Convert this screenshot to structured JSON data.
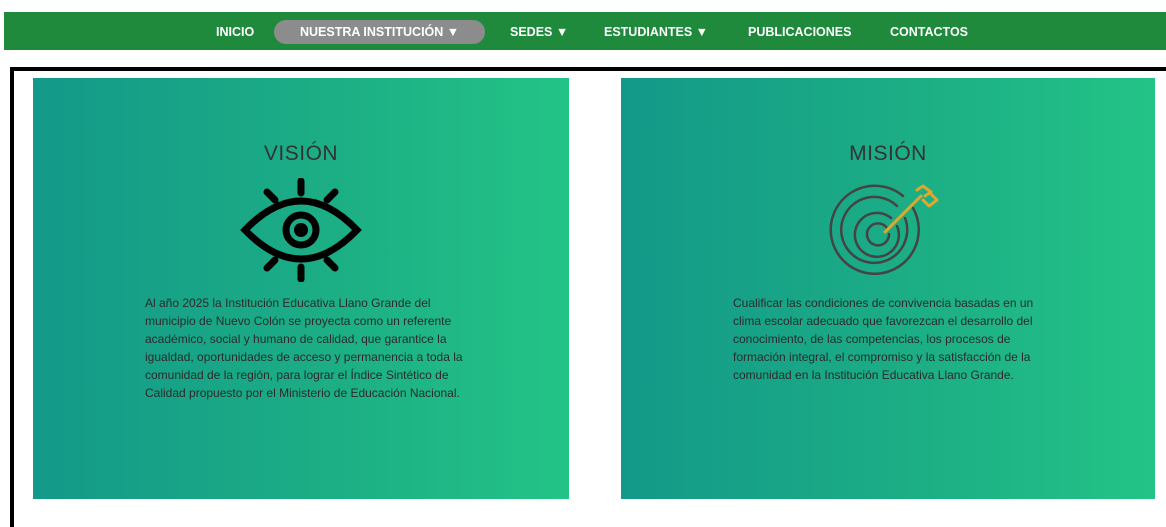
{
  "nav": {
    "items": [
      {
        "label": "INICIO"
      },
      {
        "label": "NUESTRA INSTITUCIÓN ▼"
      },
      {
        "label": "SEDES ▼"
      },
      {
        "label": "ESTUDIANTES ▼"
      },
      {
        "label": "PUBLICACIONES"
      },
      {
        "label": "CONTACTOS"
      }
    ],
    "active_index": 1
  },
  "vision": {
    "title": "VISIÓN",
    "icon": "eye-icon",
    "text": "Al año 2025 la Institución Educativa Llano Grande del municipio de Nuevo Colón se proyecta como un referente académico, social y humano de calidad, que garantice la igualdad, oportunidades de acceso y permanencia a toda la comunidad de la región, para lograr el Índice Sintético de Calidad propuesto por el Ministerio de Educación Nacional."
  },
  "mision": {
    "title": "MISIÓN",
    "icon": "target-arrow-icon",
    "text": "Cualificar las condiciones de convivencia basadas en un clima escolar adecuado que favorezcan el desarrollo del conocimiento, de las competencias, los procesos de formación integral, el compromiso y la satisfacción de la comunidad en la Institución Educativa Llano Grande."
  },
  "colors": {
    "navbar": "#1f8a3c",
    "active_pill": "#8c8c8c",
    "card_gradient_start": "#139989",
    "card_gradient_end": "#23c386",
    "arrow_accent": "#e0a82a"
  }
}
